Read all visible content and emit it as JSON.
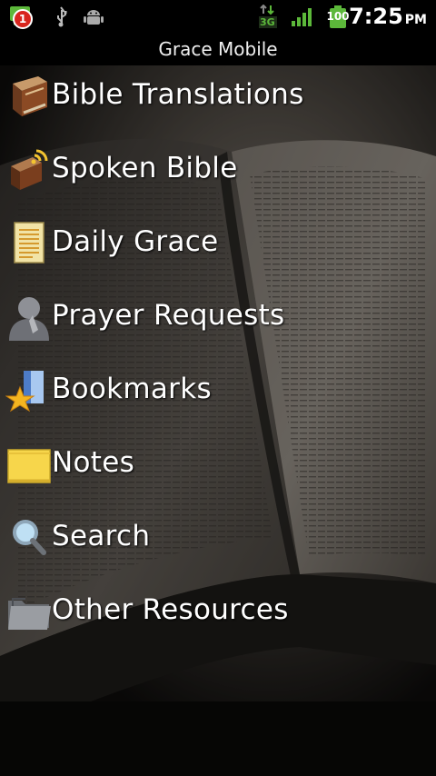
{
  "status_bar": {
    "notification_count": "1",
    "network_type": "3G",
    "battery_level": "100",
    "time": "7:25",
    "am_pm": "PM",
    "icons": [
      "message-icon",
      "usb-icon",
      "android-debug-icon",
      "data-3g-icon",
      "signal-icon",
      "battery-icon"
    ]
  },
  "app": {
    "title": "Grace Mobile"
  },
  "menu": {
    "items": [
      {
        "label": "Bible Translations",
        "icon": "bible-book-icon"
      },
      {
        "label": "Spoken Bible",
        "icon": "audio-bible-icon"
      },
      {
        "label": "Daily Grace",
        "icon": "document-icon"
      },
      {
        "label": "Prayer Requests",
        "icon": "praying-person-icon"
      },
      {
        "label": "Bookmarks",
        "icon": "bookmark-star-icon"
      },
      {
        "label": "Notes",
        "icon": "sticky-note-icon"
      },
      {
        "label": "Search",
        "icon": "magnifier-icon"
      },
      {
        "label": "Other Resources",
        "icon": "folder-icon"
      }
    ]
  }
}
